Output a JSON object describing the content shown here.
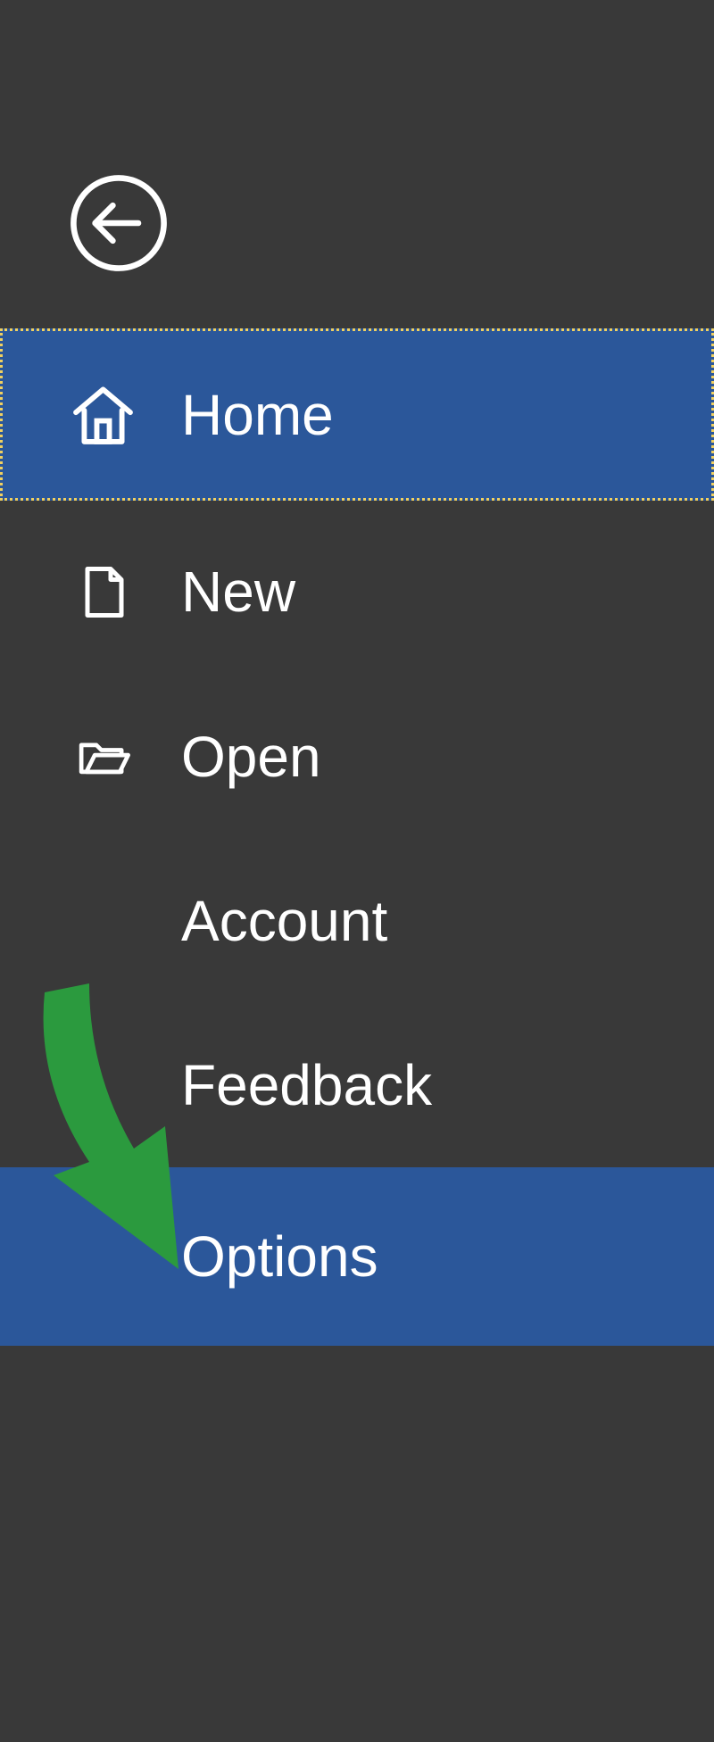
{
  "sidebar": {
    "items": [
      {
        "label": "Home"
      },
      {
        "label": "New"
      },
      {
        "label": "Open"
      },
      {
        "label": "Account"
      },
      {
        "label": "Feedback"
      },
      {
        "label": "Options"
      }
    ]
  },
  "colors": {
    "background": "#393939",
    "accent": "#2b579a",
    "focus_border": "#f0d060",
    "arrow": "#2b9a3e"
  }
}
